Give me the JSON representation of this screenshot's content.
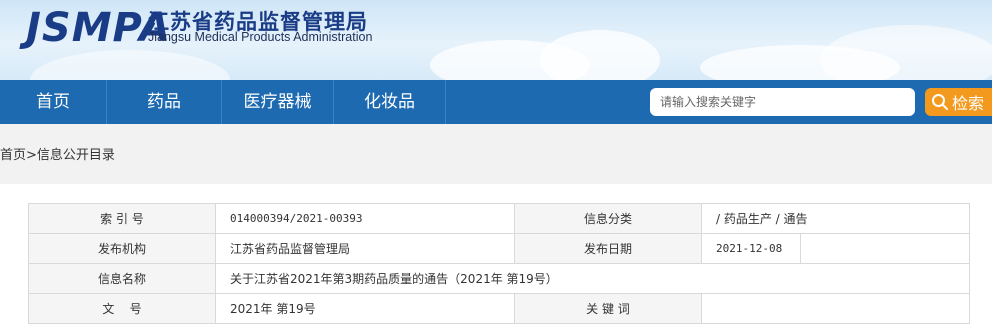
{
  "header": {
    "logo_mark": "JSMPA",
    "org_name_cn": "江苏省药品监督管理局",
    "org_name_en": "Jiangsu Medical Products Administration"
  },
  "nav": {
    "items": [
      {
        "label": "首页"
      },
      {
        "label": "药品"
      },
      {
        "label": "医疗器械"
      },
      {
        "label": "化妆品"
      }
    ]
  },
  "search": {
    "placeholder": "请输入搜索关键字",
    "button_label": "检索",
    "icon": "search-icon"
  },
  "breadcrumb": {
    "home": "首页",
    "separator": ">",
    "current": "信息公开目录"
  },
  "info": {
    "index_label": "索 引 号",
    "index_value": "014000394/2021-00393",
    "category_label": "信息分类",
    "category_value": "/  药品生产  /  通告",
    "publisher_label": "发布机构",
    "publisher_value": "江苏省药品监督管理局",
    "date_label": "发布日期",
    "date_value": "2021-12-08",
    "title_label": "信息名称",
    "title_value": "关于江苏省2021年第3期药品质量的通告（2021年 第19号）",
    "docno_label": "文    号",
    "docno_value": "2021年 第19号",
    "keywords_label": "关 键 词",
    "keywords_value": ""
  },
  "colors": {
    "nav_bg": "#1d6ab1",
    "search_button": "#f39a1e",
    "logo": "#1a3c86"
  }
}
